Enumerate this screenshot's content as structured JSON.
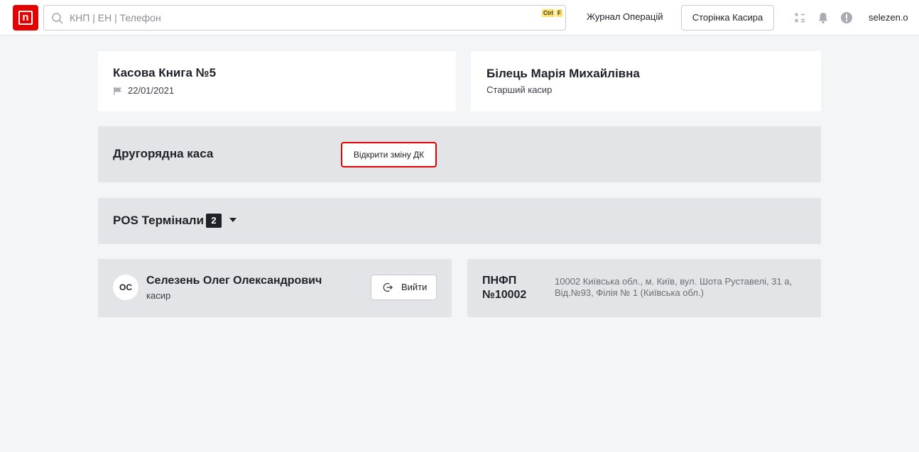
{
  "header": {
    "logo_letter": "n",
    "search": {
      "placeholder": "КНП | ЕН | Телефон",
      "value": "",
      "shortcut_ctrl": "Ctrl",
      "shortcut_key": "F"
    },
    "operations_journal_label": "Журнал Операцій",
    "cashier_page_label": "Сторінка Касира",
    "username": "selezen.o",
    "icons": [
      "calculator-icon",
      "bell-icon",
      "alert-icon"
    ]
  },
  "cash_book": {
    "title": "Касова Книга №5",
    "date": "22/01/2021"
  },
  "senior_cashier": {
    "name": "Білець Марія Михайлівна",
    "role": "Старший касир"
  },
  "secondary_register": {
    "title": "Другорядна каса",
    "open_shift_label": "Відкрити зміну ДК"
  },
  "pos_terminals": {
    "title": "POS Термінали",
    "count": "2"
  },
  "cashier": {
    "initials": "ОС",
    "name": "Селезень Олег Олександрович",
    "role": "касир",
    "logout_label": "Вийти"
  },
  "branch": {
    "code": "ПНФП №10002",
    "address": "10002 Київська обл., м. Київ, вул. Шота Руставелі, 31 а, Від.№93, Філія № 1 (Київська обл.)"
  },
  "colors": {
    "brand": "#e60000",
    "background": "#f4f5f7",
    "panel_grey": "#e3e4e8",
    "badge_yellow": "#ffe26a"
  }
}
